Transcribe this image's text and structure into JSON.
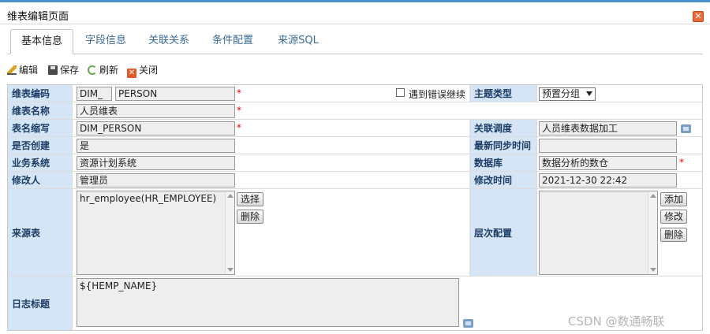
{
  "window": {
    "title": "维表编辑页面"
  },
  "tabs": [
    {
      "label": "基本信息"
    },
    {
      "label": "字段信息"
    },
    {
      "label": "关联关系"
    },
    {
      "label": "条件配置"
    },
    {
      "label": "来源SQL"
    }
  ],
  "toolbar": {
    "edit": "编辑",
    "save": "保存",
    "refresh": "刷新",
    "close": "关闭"
  },
  "form": {
    "code_label": "维表编码",
    "code_prefix": "DIM_",
    "code_value": "PERSON",
    "continue_on_error": "遇到错误继续",
    "theme_type_label": "主题类型",
    "theme_type_value": "预置分组",
    "name_label": "维表名称",
    "name_value": "人员维表",
    "abbr_label": "表名缩写",
    "abbr_value": "DIM_PERSON",
    "schedule_label": "关联调度",
    "schedule_value": "人员维表数据加工",
    "created_label": "是否创建",
    "created_value": "是",
    "sync_time_label": "最新同步时间",
    "sync_time_value": "",
    "system_label": "业务系统",
    "system_value": "资源计划系统",
    "db_label": "数据库",
    "db_value": "数据分析的数仓",
    "modifier_label": "修改人",
    "modifier_value": "管理员",
    "mod_time_label": "修改时间",
    "mod_time_value": "2021-12-30 22:42",
    "source_label": "来源表",
    "source_value": "hr_employee(HR_EMPLOYEE)",
    "select_btn": "选择",
    "delete_btn": "删除",
    "level_label": "层次配置",
    "add_btn": "添加",
    "modify_btn": "修改",
    "level_delete_btn": "删除",
    "log_title_label": "日志标题",
    "log_title_value": "${HEMP_NAME}",
    "required_mark": "*"
  },
  "watermark": "CSDN @数通畅联"
}
